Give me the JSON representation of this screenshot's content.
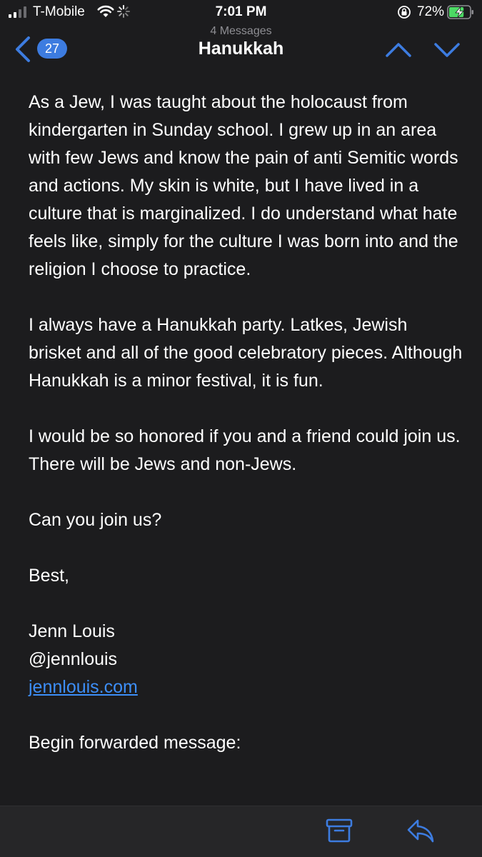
{
  "status_bar": {
    "carrier": "T-Mobile",
    "time": "7:01 PM",
    "battery_percent": "72%",
    "battery_level": 0.72,
    "icons": [
      "signal-icon",
      "wifi-icon",
      "activity-spinner-icon",
      "rotation-lock-icon",
      "battery-charging-icon"
    ]
  },
  "nav": {
    "back_count": "27",
    "message_count": "4 Messages",
    "title": "Hanukkah",
    "accent_color": "#3d7ce0"
  },
  "message": {
    "paragraph1": "As a Jew, I was taught about the holocaust from kindergarten in Sunday school. I grew up in an area with few Jews and know the pain of anti Semitic words and actions. My skin is white, but I have lived in a culture that is marginalized. I do understand what hate feels like, simply for the culture I was born into and the religion I choose to practice.",
    "paragraph2": "I always have a Hanukkah party. Latkes, Jewish brisket and all of the good celebratory pieces. Although Hanukkah is a minor festival, it is fun.",
    "paragraph3": "I would be so honored if you and a friend could join us. There will be Jews and non-Jews.",
    "paragraph4": "Can you join us?",
    "closing": "Best,",
    "signature_name": "Jenn Louis",
    "signature_handle": "@jennlouis",
    "signature_link": "jennlouis.com",
    "forwarded_label": "Begin forwarded message:"
  },
  "toolbar": {
    "icons": [
      "archive-icon",
      "reply-icon"
    ]
  }
}
